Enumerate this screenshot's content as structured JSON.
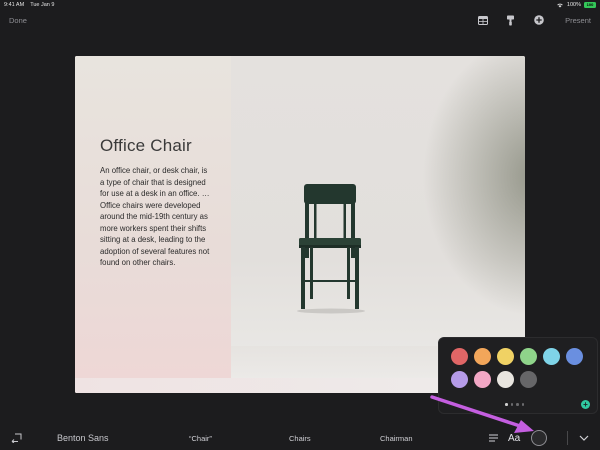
{
  "status_bar": {
    "time": "9:41 AM",
    "date": "Tue Jan 9",
    "battery": "100%",
    "battery_badge": "100"
  },
  "toolbar": {
    "done_label": "Done",
    "present_label": "Present",
    "icons": [
      "table-icon",
      "paintbrush-icon",
      "add-icon"
    ]
  },
  "slide": {
    "title": "Office Chair",
    "body": "An office chair, or desk chair, is a type of chair that is designed for use at a desk in an office. … Office chairs were developed around the mid-19th century as more workers spent their shifts sitting at a desk, leading to the adoption of several features not found on other chairs."
  },
  "color_picker": {
    "swatches": [
      "#e06666",
      "#f2a65a",
      "#f0d264",
      "#8fd48a",
      "#7fd4e8",
      "#6a8fe0",
      "#b59be8",
      "#f2a7c5",
      "#e8e5df",
      "#666668"
    ],
    "page_count": 4,
    "active_page": 0
  },
  "bottom_bar": {
    "font_name": "Benton Sans",
    "suggestions": [
      "“Chair”",
      "Chairs",
      "Chairman"
    ],
    "text_style_label": "Aa"
  },
  "colors": {
    "background": "#1c1c1e",
    "accent_arrow": "#c45ee0",
    "add_button": "#30c8a0"
  }
}
